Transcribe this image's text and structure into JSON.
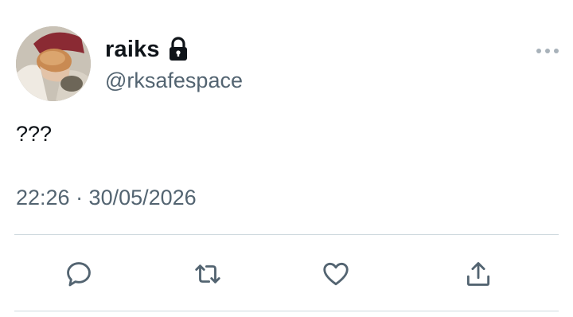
{
  "tweet": {
    "author": {
      "display_name": "raiks",
      "handle": "@rksafespace",
      "protected_icon": "lock-icon",
      "avatar_icon": "avatar"
    },
    "text": "???",
    "timestamp": "22:26 · 30/05/2026"
  },
  "actions": [
    {
      "name": "reply",
      "icon": "reply-icon"
    },
    {
      "name": "retweet",
      "icon": "retweet-icon"
    },
    {
      "name": "like",
      "icon": "heart-icon"
    },
    {
      "name": "share",
      "icon": "share-icon"
    }
  ],
  "menu_icon": "more-icon",
  "colors": {
    "text_primary": "#0f1419",
    "text_secondary": "#536471",
    "divider": "#cfd9de"
  }
}
